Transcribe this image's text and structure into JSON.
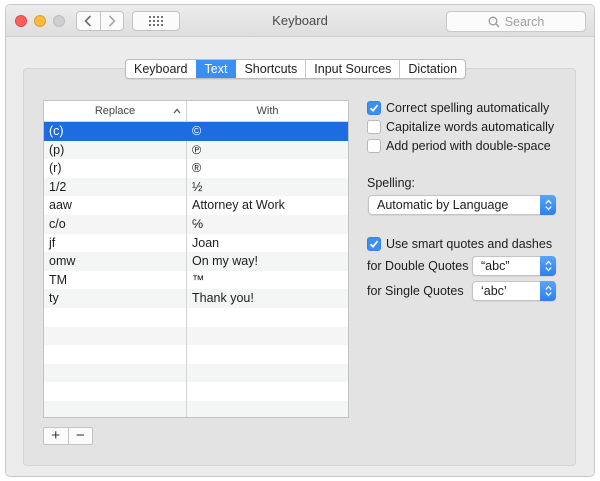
{
  "window": {
    "title": "Keyboard"
  },
  "search": {
    "placeholder": "Search"
  },
  "tabs": [
    {
      "label": "Keyboard",
      "active": false
    },
    {
      "label": "Text",
      "active": true
    },
    {
      "label": "Shortcuts",
      "active": false
    },
    {
      "label": "Input Sources",
      "active": false
    },
    {
      "label": "Dictation",
      "active": false
    }
  ],
  "table": {
    "columns": {
      "replace": "Replace",
      "with": "With"
    },
    "rows": [
      {
        "replace": "(c)",
        "with": "©",
        "selected": true
      },
      {
        "replace": "(p)",
        "with": "℗"
      },
      {
        "replace": "(r)",
        "with": "®"
      },
      {
        "replace": "1/2",
        "with": "½"
      },
      {
        "replace": "aaw",
        "with": "Attorney at Work"
      },
      {
        "replace": "c/o",
        "with": "℅"
      },
      {
        "replace": "jf",
        "with": "Joan"
      },
      {
        "replace": "omw",
        "with": "On my way!"
      },
      {
        "replace": "TM",
        "with": "™"
      },
      {
        "replace": "ty",
        "with": "Thank you!"
      }
    ],
    "add_label": "+",
    "remove_label": "−"
  },
  "options": {
    "correct_spelling": {
      "label": "Correct spelling automatically",
      "checked": true
    },
    "capitalize_words": {
      "label": "Capitalize words automatically",
      "checked": false
    },
    "add_period": {
      "label": "Add period with double-space",
      "checked": false
    },
    "spelling_label": "Spelling:",
    "spelling_value": "Automatic by Language",
    "smart_quotes": {
      "label": "Use smart quotes and dashes",
      "checked": true
    },
    "double_quotes_label": "for Double Quotes",
    "double_quotes_value": "“abc”",
    "single_quotes_label": "for Single Quotes",
    "single_quotes_value": "‘abc’"
  },
  "colors": {
    "accent": "#3b8ff1",
    "selection": "#1d6de0"
  }
}
